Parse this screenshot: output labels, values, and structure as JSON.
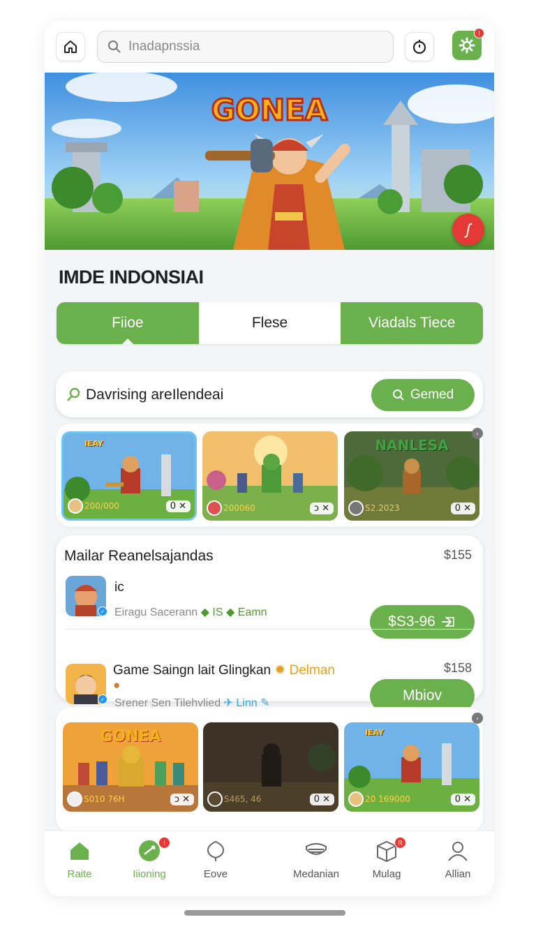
{
  "header": {
    "search_placeholder": "Inadapnssia",
    "settings_badge": "!"
  },
  "hero": {
    "title": "GONEA",
    "badge_glyph": "ʃ"
  },
  "section_title": "IMDE INDONSIAI",
  "tabs": [
    {
      "label": "Fiioe",
      "active": true
    },
    {
      "label": "Flese",
      "active": false
    },
    {
      "label": "Viadals Tiece",
      "active": false
    }
  ],
  "search_bar": {
    "label": "Davrising areIlendeai",
    "button_label": "Gemed"
  },
  "cards_row_1": [
    {
      "title": "IEAY",
      "price": "200/000",
      "ctrl": "0 ✕"
    },
    {
      "title": "",
      "price": "200060",
      "ctrl": "ↄ ✕"
    },
    {
      "title": "NANLESA",
      "price": "S2.2023",
      "ctrl": "0 ✕"
    }
  ],
  "listing": {
    "heading": "Mailar Reanelsajandas",
    "heading_price": "$155",
    "items": [
      {
        "title": "ic",
        "sub_prefix": "Eiragu Sacerann",
        "tag1": "IS",
        "tag2": "Eamn",
        "button_label": "$S3-96",
        "price": ""
      },
      {
        "title": "Game Saingn lait Glingkan",
        "title_tag": "Delman",
        "sub_prefix": "Srener Sen Tilehvlied",
        "tag1": "Linn",
        "tag2": "",
        "button_label": "Mbiov",
        "price": "$158"
      }
    ]
  },
  "cards_row_2": [
    {
      "title": "GONEA",
      "price": "S010 76H",
      "ctrl": "ↄ ✕"
    },
    {
      "title": "",
      "price": "S465, 46",
      "ctrl": "0 ✕"
    },
    {
      "title": "IEAY",
      "price": "20 169000",
      "ctrl": "0 ✕"
    }
  ],
  "bottom_nav": [
    {
      "label": "Raite",
      "icon": "home-icon",
      "active": true,
      "badge": ""
    },
    {
      "label": "Iiioning",
      "icon": "chat-icon",
      "active": true,
      "badge": "!"
    },
    {
      "label": "Eove",
      "icon": "shield-icon",
      "active": false,
      "badge": ""
    },
    {
      "label": "Medanian",
      "icon": "helmet-icon",
      "active": false,
      "badge": ""
    },
    {
      "label": "Mulag",
      "icon": "box-icon",
      "active": false,
      "badge": "R"
    },
    {
      "label": "Allian",
      "icon": "user-icon",
      "active": false,
      "badge": ""
    }
  ],
  "colors": {
    "accent_green": "#6ab04c",
    "badge_red": "#e53935",
    "link_blue": "#36a6e0"
  }
}
